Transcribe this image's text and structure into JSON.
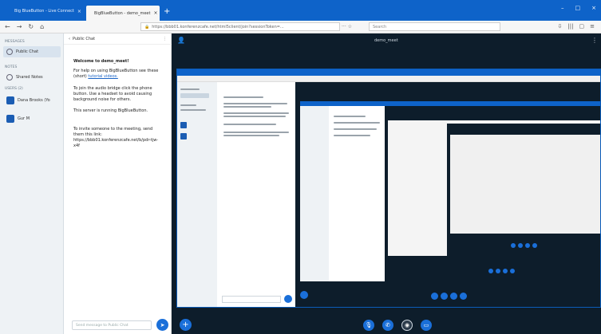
{
  "browser": {
    "tabs": [
      {
        "label": "Big BlueButton - Live Connect"
      },
      {
        "label": "BigBlueButton - demo_meet"
      }
    ],
    "url": "https://bbb01.konferenzcafe.net/html5client/join?sessionToken=...",
    "search_placeholder": "Search"
  },
  "sidebar": {
    "messages_header": "MESSAGES",
    "messages_item": "Public Chat",
    "notes_header": "NOTES",
    "notes_item": "Shared Notes",
    "users_header": "USERS (2)",
    "users": [
      {
        "name": "Dana Brooks (Yo"
      },
      {
        "name": "Gur M"
      }
    ]
  },
  "chat": {
    "header": "Public Chat",
    "messages": [
      {
        "bold": "Welcome to demo_meet!"
      },
      {
        "text": "For help on using BigBlueButton see these (short)",
        "link": "tutorial videos."
      },
      {
        "text": "To join the audio bridge click the phone button. Use a headset to avoid causing background noise for others."
      },
      {
        "text": "This server is running BigBlueButton."
      },
      {
        "text": "To invite someone to the meeting, send them this link: https://bbb01.konferenzcafe.net/b/pdr-tjw-x4f"
      }
    ],
    "input_placeholder": "Send message to Public Chat"
  },
  "stage": {
    "title": "demo_meet"
  },
  "colors": {
    "brand": "#0e63c9",
    "stage": "#0d1d2b",
    "button": "#1a6fd9"
  }
}
